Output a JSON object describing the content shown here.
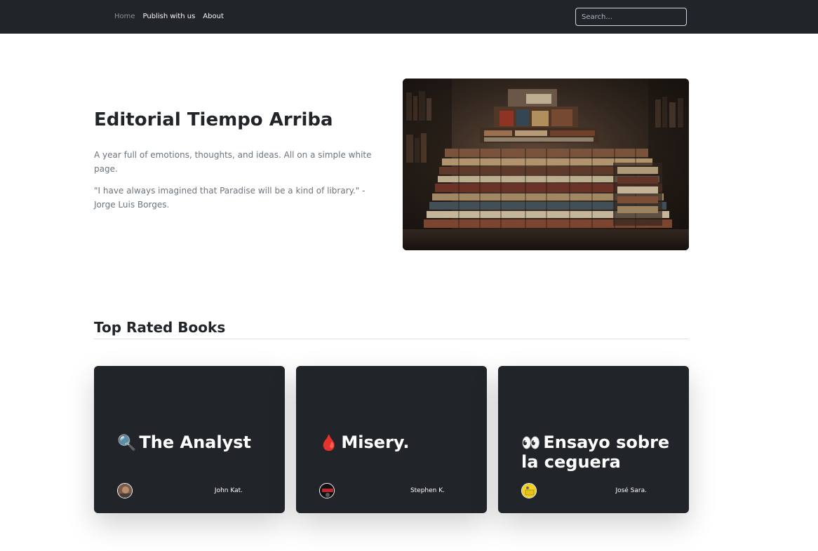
{
  "nav": {
    "links": [
      {
        "label": "Home"
      },
      {
        "label": "Publish with us"
      },
      {
        "label": "About"
      }
    ],
    "search_placeholder": "Search..."
  },
  "hero": {
    "title": "Editorial Tiempo Arriba",
    "lead": "A year full of emotions, thoughts, and ideas. All on a simple white page.",
    "quote": "\"I have always imagined that Paradise will be a kind of library.\" - Jorge Luis Borges.",
    "image_icon": "bookshelf-photo"
  },
  "section": {
    "title": "Top Rated Books"
  },
  "cards": [
    {
      "emoji": "🔍",
      "title": "The Analyst",
      "author": "John Kat."
    },
    {
      "emoji": "🩸",
      "title": "Misery.",
      "author": "Stephen K."
    },
    {
      "emoji": "👀",
      "title": "Ensayo sobre la ceguera",
      "author": "José Sara."
    }
  ],
  "colors": {
    "navbar": "#212529",
    "card_bg": "#212529",
    "text_muted": "#6c757d"
  }
}
